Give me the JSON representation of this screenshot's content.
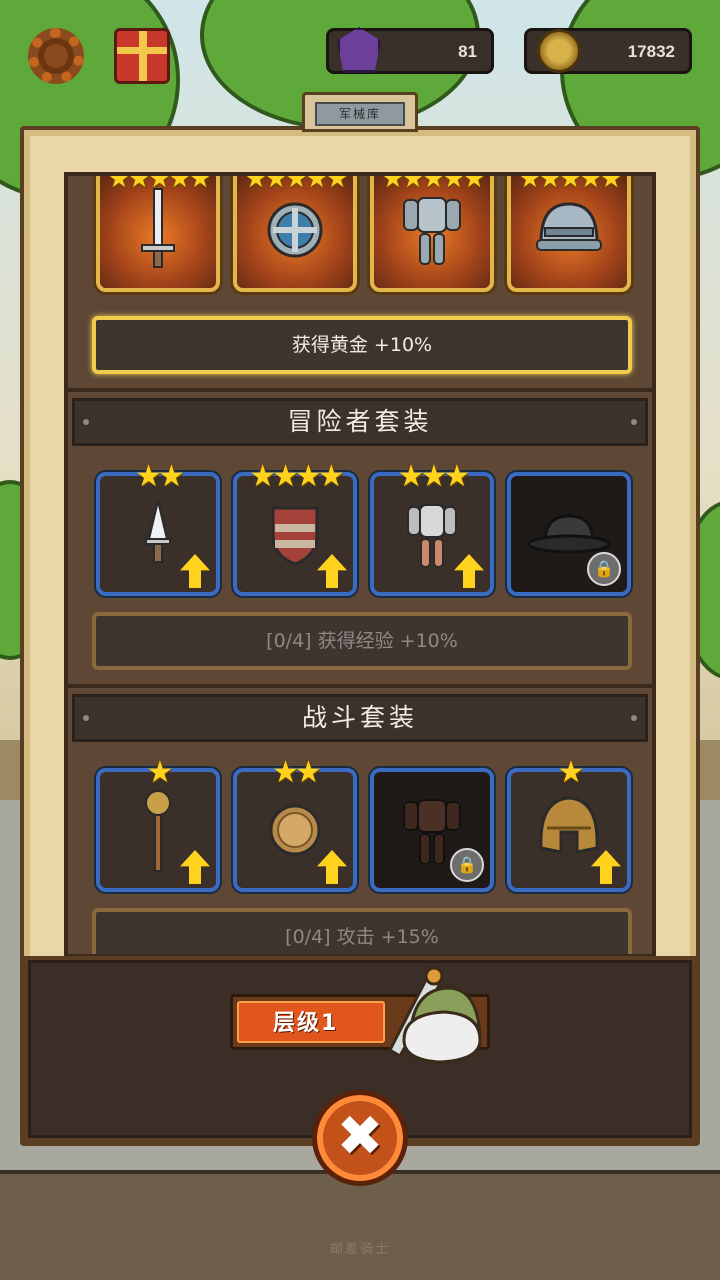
{
  "hud": {
    "settings_icon": "gear-icon",
    "gift_icon": "gift-icon",
    "gems": {
      "icon": "gem-icon",
      "value": "81"
    },
    "gold": {
      "icon": "coin-icon",
      "value": "17832"
    }
  },
  "panel": {
    "title": "军械库",
    "top_set": {
      "items": [
        {
          "icon": "sword-icon",
          "stars": "★★★★★"
        },
        {
          "icon": "round-shield-icon",
          "stars": "★★★★★"
        },
        {
          "icon": "plate-armor-icon",
          "stars": "★★★★★"
        },
        {
          "icon": "knight-helmet-icon",
          "stars": "★★★★★"
        }
      ],
      "bonus": "获得黄金 +10%"
    },
    "sets": [
      {
        "name": "冒险者套装",
        "items": [
          {
            "icon": "dagger-icon",
            "stars": "★★",
            "upgrade": true,
            "locked": false
          },
          {
            "icon": "wooden-shield-icon",
            "stars": "★★★★",
            "upgrade": true,
            "locked": false
          },
          {
            "icon": "chain-armor-icon",
            "stars": "★★★",
            "upgrade": true,
            "locked": false
          },
          {
            "icon": "iron-cap-icon",
            "stars": "",
            "upgrade": false,
            "locked": true
          }
        ],
        "bonus": "[0/4] 获得经验 +10%"
      },
      {
        "name": "战斗套装",
        "items": [
          {
            "icon": "mace-icon",
            "stars": "★",
            "upgrade": true,
            "locked": false
          },
          {
            "icon": "buckler-icon",
            "stars": "★★",
            "upgrade": true,
            "locked": false
          },
          {
            "icon": "leather-armor-icon",
            "stars": "",
            "upgrade": false,
            "locked": true
          },
          {
            "icon": "bronze-helmet-icon",
            "stars": "★",
            "upgrade": true,
            "locked": false
          }
        ],
        "bonus": "[0/4] 攻击 +15%"
      }
    ]
  },
  "level": {
    "label": "层级1",
    "progress": 0.6
  },
  "close_icon": "✖",
  "lock_icon": "🔒",
  "footer": "邮差骑士",
  "colors": {
    "accent": "#e0561c",
    "gold": "#ffd21e",
    "frame_blue": "#3a6bc0"
  }
}
